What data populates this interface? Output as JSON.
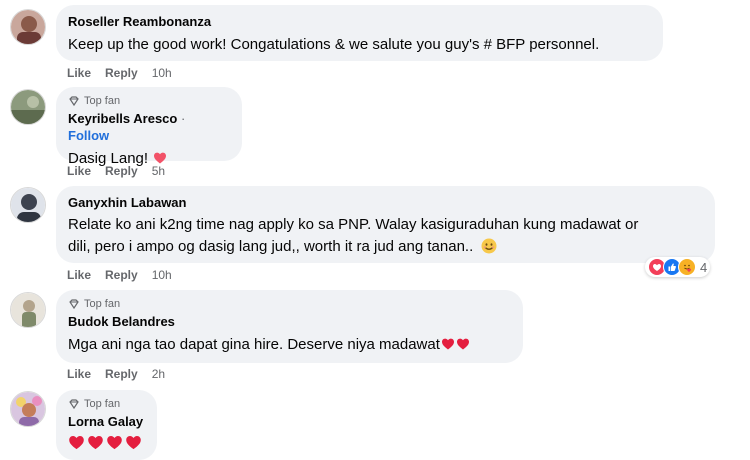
{
  "comments": [
    {
      "author": "Roseller Reambonanza",
      "top_fan": false,
      "text": "Keep up the good work! Congatulations & we salute you guy's # BFP personnel.",
      "like": "Like",
      "reply": "Reply",
      "time": "10h"
    },
    {
      "author": "Keyribells Aresco",
      "top_fan": true,
      "top_fan_label": "Top fan",
      "separator": "·",
      "follow": "Follow",
      "text": "Dasig Lang!",
      "like": "Like",
      "reply": "Reply",
      "time": "5h"
    },
    {
      "author": "Ganyxhin Labawan",
      "top_fan": false,
      "text_line1": "Relate ko ani k2ng time nag apply ko sa PNP. Walay kasiguraduhan kung madawat or",
      "text_line2": "dili, pero i ampo og dasig lang jud,, worth it ra jud ang tanan..",
      "like": "Like",
      "reply": "Reply",
      "time": "10h",
      "reaction_count": "4",
      "reaction_icons": [
        "love-icon",
        "like-icon",
        "care-icon"
      ]
    },
    {
      "author": "Budok Belandres",
      "top_fan": true,
      "top_fan_label": "Top fan",
      "text": "Mga ani nga tao dapat gina hire. Deserve niya madawat",
      "like": "Like",
      "reply": "Reply",
      "time": "2h"
    },
    {
      "author": "Lorna Galay",
      "top_fan": true,
      "top_fan_label": "Top fan",
      "text": ""
    }
  ],
  "colors": {
    "bubble": "#f0f2f5",
    "meta_gray": "#65676b",
    "follow_blue": "#216fdb",
    "heart_red": "#e41e3f",
    "pink_heart": "#f25268"
  }
}
